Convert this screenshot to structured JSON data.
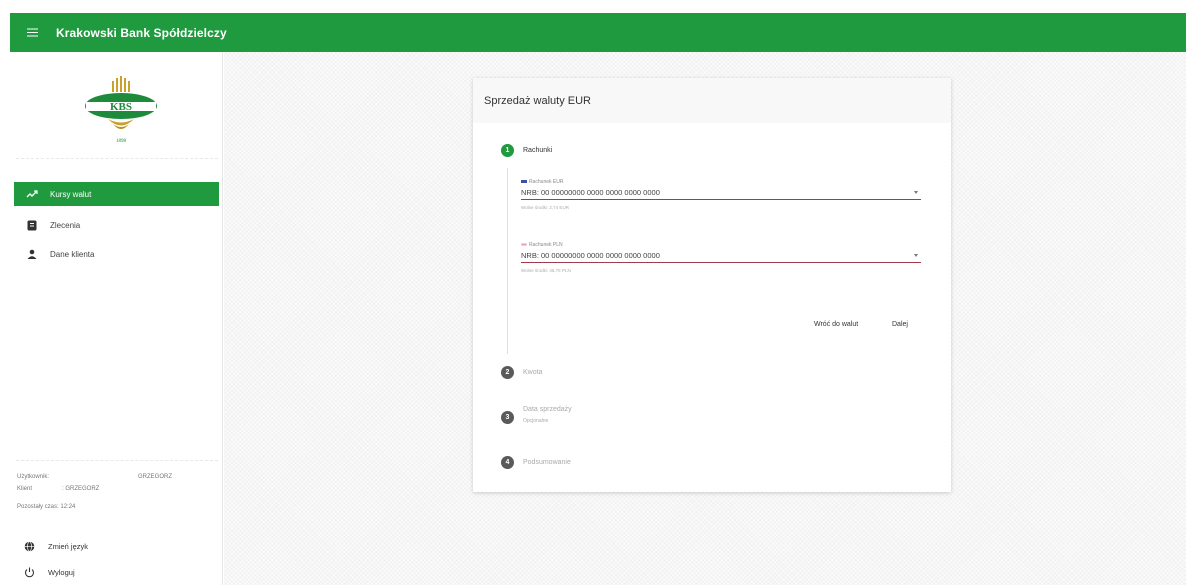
{
  "header": {
    "title": "Krakowski Bank Spółdzielczy"
  },
  "logo": {
    "letters": "KBS",
    "year": "1898"
  },
  "sidebar": {
    "items": [
      {
        "label": "Kursy walut",
        "icon": "trending-up-icon",
        "active": true
      },
      {
        "label": "Zlecenia",
        "icon": "order-icon",
        "active": false
      },
      {
        "label": "Dane klienta",
        "icon": "person-icon",
        "active": false
      }
    ],
    "user": {
      "user_label": "Użytkownik:",
      "user_value": "GRZEGORZ",
      "client_label": "Klient",
      "client_value": ": GRZEGORZ",
      "time_text": "Pozostały czas: 12:24"
    },
    "language_label": "Zmień język",
    "logout_label": "Wyloguj"
  },
  "card": {
    "title": "Sprzedaż waluty EUR",
    "steps": [
      {
        "number": "1",
        "label": "Rachunki",
        "sublabel": "",
        "active": true
      },
      {
        "number": "2",
        "label": "Kwota",
        "sublabel": "",
        "active": false
      },
      {
        "number": "3",
        "label": "Data sprzedaży",
        "sublabel": "Opcjonalne",
        "active": false
      },
      {
        "number": "4",
        "label": "Podsumowanie",
        "sublabel": "",
        "active": false
      }
    ],
    "eur_account": {
      "label": "Rachunek EUR",
      "value": "NRB: 00 00000000 0000 0000 0000 0000",
      "hint": "Wolne środki: 2,74 EUR"
    },
    "pln_account": {
      "label": "Rachunek PLN",
      "value": "NRB: 00 00000000 0000 0000 0000 0000",
      "hint": "Wolne środki: 46,75 PLN"
    },
    "back_button": "Wróć do walut",
    "next_button": "Dalej"
  },
  "colors": {
    "brand": "#1f9a3f",
    "active_step": "#1f9a3f",
    "inactive_step": "#5a5a5a",
    "underline": "#a33c4a",
    "eur_flag": "#3b4fa8",
    "pln_flag": "#d8334a"
  }
}
